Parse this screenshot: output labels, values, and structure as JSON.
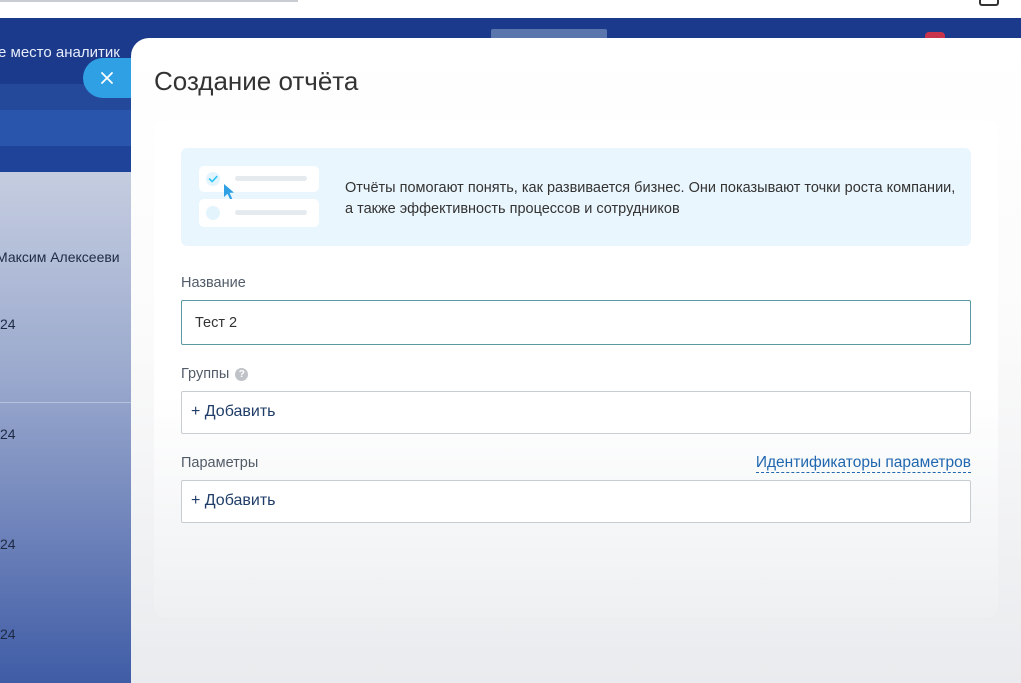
{
  "background": {
    "header_title": "е место аналитик",
    "user_name": "Максим Алексееви",
    "row_cells": [
      "24",
      "24",
      "24",
      "24"
    ]
  },
  "slider": {
    "title": "Создание отчёта",
    "close_icon": "close-icon",
    "info": {
      "text": "Отчёты помогают понять, как развивается бизнес. Они показывают точки роста компании, а также эффективность процессов и сотрудников"
    },
    "fields": {
      "name_label": "Название",
      "name_value": "Тест 2",
      "groups_label": "Группы",
      "groups_help_icon": "question-circle-icon",
      "groups_add": "+ Добавить",
      "params_label": "Параметры",
      "params_link": "Идентификаторы параметров",
      "params_add": "+ Добавить"
    }
  },
  "colors": {
    "close_button": "#2fa0e4",
    "link": "#2067b0",
    "info_bg": "#eaf6fd",
    "active_border": "#5a9aa0"
  }
}
